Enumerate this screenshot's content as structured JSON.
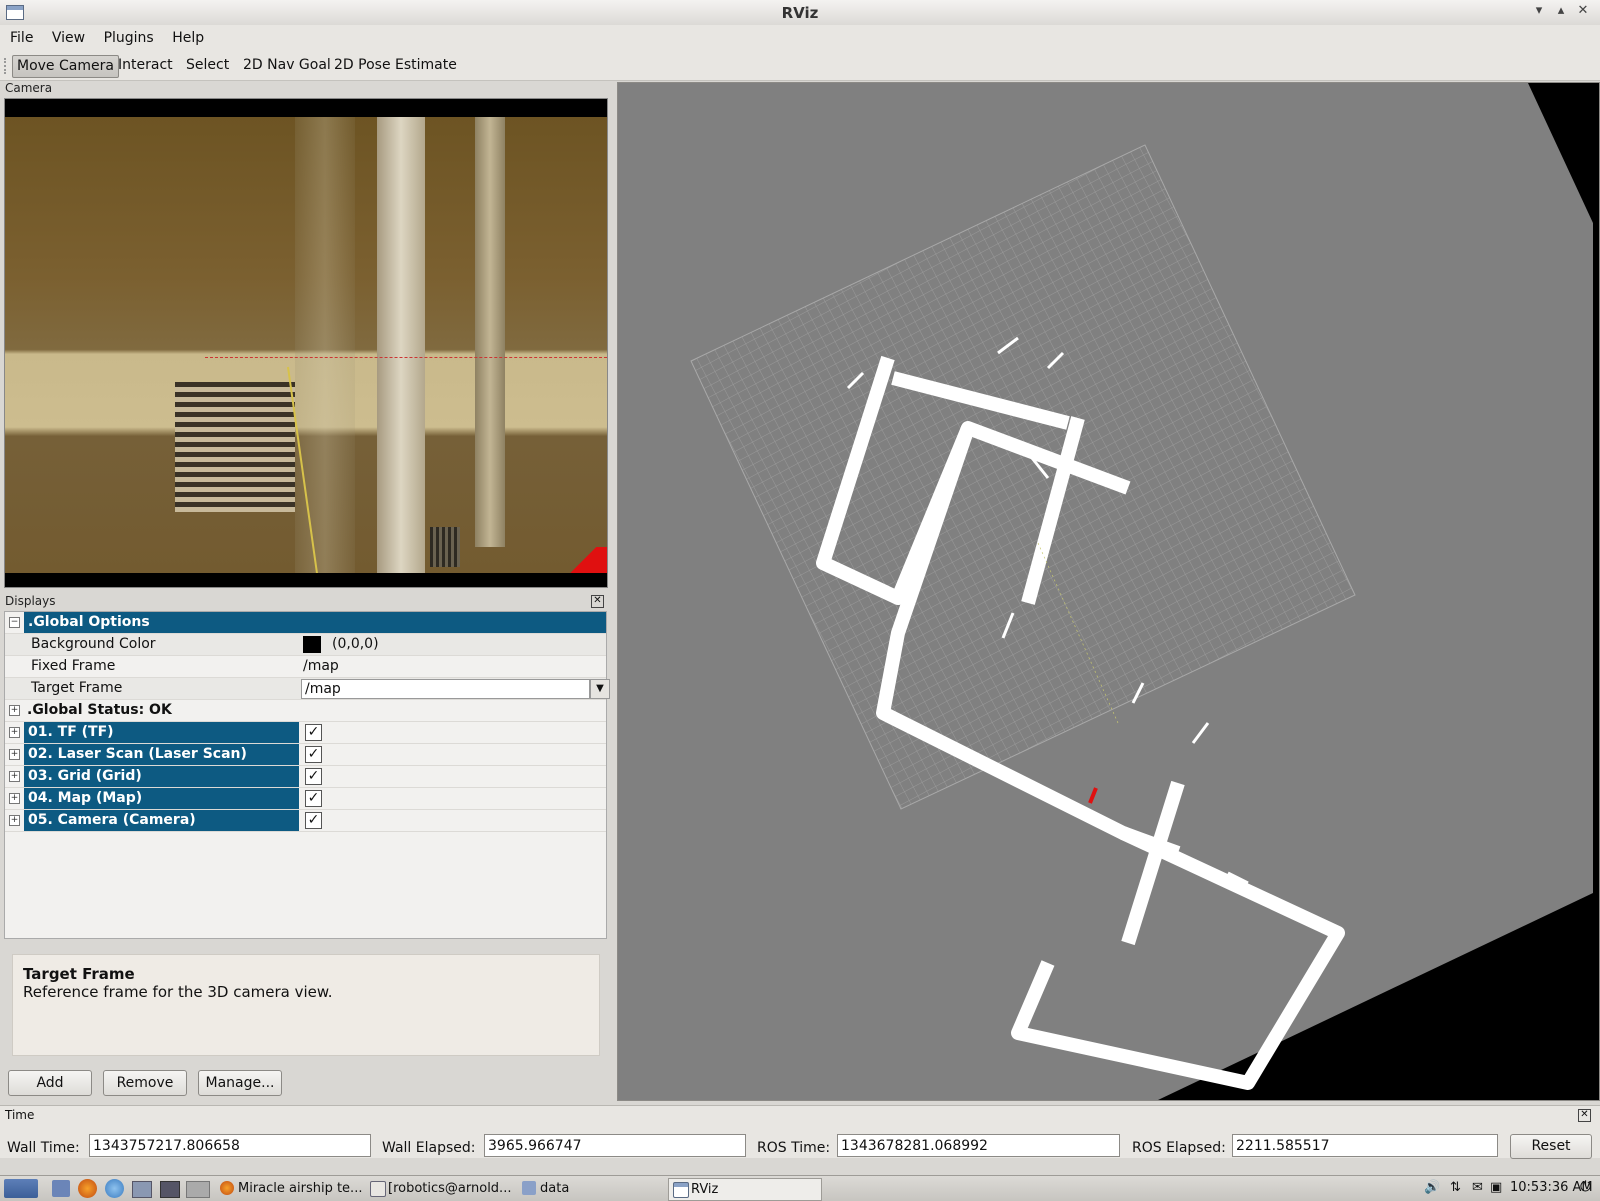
{
  "window": {
    "title": "RViz"
  },
  "menu": [
    "File",
    "View",
    "Plugins",
    "Help"
  ],
  "toolbar": [
    "Move Camera",
    "Interact",
    "Select",
    "2D Nav Goal",
    "2D Pose Estimate"
  ],
  "camera_panel": {
    "title": "Camera"
  },
  "displays_panel": {
    "title": "Displays",
    "global_options": ".Global Options",
    "background_color_label": "Background Color",
    "background_color_value": "(0,0,0)",
    "fixed_frame_label": "Fixed Frame",
    "fixed_frame_value": "/map",
    "target_frame_label": "Target Frame",
    "target_frame_value": "/map",
    "global_status": ".Global Status: OK",
    "items": [
      {
        "label": "01. TF (TF)",
        "checked": true
      },
      {
        "label": "02. Laser Scan (Laser Scan)",
        "checked": true
      },
      {
        "label": "03. Grid (Grid)",
        "checked": true
      },
      {
        "label": "04. Map (Map)",
        "checked": true
      },
      {
        "label": "05. Camera (Camera)",
        "checked": true
      }
    ],
    "check_mark": "✓"
  },
  "help": {
    "title": "Target Frame",
    "text": "Reference frame for the 3D camera view."
  },
  "buttons": {
    "add": "Add",
    "remove": "Remove",
    "manage": "Manage..."
  },
  "time_panel": {
    "title": "Time",
    "wall_time_label": "Wall Time:",
    "wall_time": "1343757217.806658",
    "wall_elapsed_label": "Wall Elapsed:",
    "wall_elapsed": "3965.966747",
    "ros_time_label": "ROS Time:",
    "ros_time": "1343678281.068992",
    "ros_elapsed_label": "ROS Elapsed:",
    "ros_elapsed": "2211.585517",
    "reset": "Reset"
  },
  "taskbar": {
    "tasks": [
      "Miracle airship te...",
      "[robotics@arnold...",
      "data",
      "RViz"
    ],
    "clock": "10:53:36 AM"
  },
  "colors": {
    "selection": "#0d5a82",
    "background_swatch": "#000000",
    "map_gray": "#808080"
  }
}
